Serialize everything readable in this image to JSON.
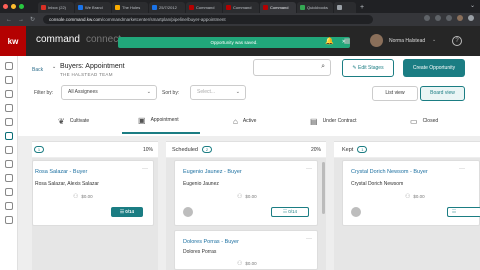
{
  "browser": {
    "tabs": [
      {
        "title": "Inbox (22)",
        "color": "#d93025"
      },
      {
        "title": "We Brand",
        "color": "#1a73e8"
      },
      {
        "title": "The Holes",
        "color": "#f9ab00"
      },
      {
        "title": "25/7/2012",
        "color": "#1a73e8"
      },
      {
        "title": "Command",
        "color": "#b40101"
      },
      {
        "title": "Command",
        "color": "#b40101"
      },
      {
        "title": "Command",
        "color": "#b40101"
      },
      {
        "title": "Quickbooks",
        "color": "#34a853"
      },
      {
        "title": "",
        "color": "#9aa0a6"
      }
    ],
    "url_host": "console.command.kw.com",
    "url_path": "/commandmarketcenter/smartplan/pipeline/buyer-appointment"
  },
  "app": {
    "logo": "kw",
    "title": "command",
    "subtitle": "connect",
    "toast": "Opportunity was saved.",
    "user_name": "Norma Halstead"
  },
  "page": {
    "back": "Back",
    "title": "Buyers: Appointment",
    "team": "THE HALSTEAD TEAM",
    "edit_stages": "Edit Stages",
    "create": "Create Opportunity",
    "filter_label": "Filter by:",
    "filter_value": "All Assignees",
    "sort_label": "Sort by:",
    "sort_placeholder": "Select...",
    "list_view": "List view",
    "board_view": "Board view"
  },
  "stages": [
    "Cultivate",
    "Appointment",
    "Active",
    "Under Contract",
    "Closed"
  ],
  "columns": [
    {
      "name": "",
      "count": "1",
      "pct": "10%"
    },
    {
      "name": "Scheduled",
      "count": "2",
      "pct": "20%"
    },
    {
      "name": "Kept",
      "count": "1",
      "pct": ""
    }
  ],
  "cards": [
    {
      "name": "Rosa Salazar - Buyer",
      "person": "Rosa Salazar, Alexis Salazar",
      "value": "$0.00",
      "task": "0/14"
    },
    {
      "name": "Eugenio Jaunez - Buyer",
      "person": "Eugenio Jaunez",
      "value": "$0.00",
      "task": "0/14"
    },
    {
      "name": "Dolores Porras - Buyer",
      "person": "Dolores Porras",
      "value": "$0.00",
      "task": ""
    },
    {
      "name": "Crystal Dorich Newsom - Buyer",
      "person": "Crystal Dorich Newsom",
      "value": "$0.00",
      "task": "0/14"
    }
  ]
}
